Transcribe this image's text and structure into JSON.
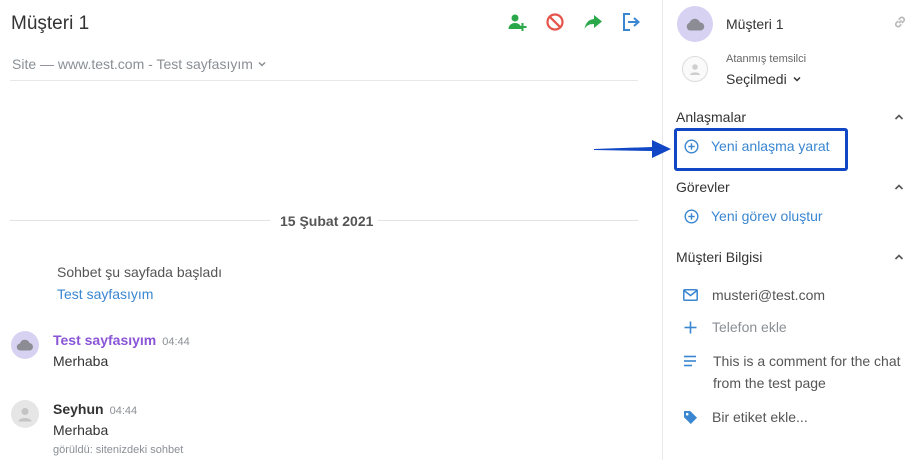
{
  "chat": {
    "title": "Müşteri 1",
    "site_line": "Site — www.test.com - Test sayfasıyım",
    "date_separator": "15 Şubat 2021",
    "system_message": "Sohbet şu sayfada başladı",
    "system_link": "Test sayfasıyım",
    "messages": [
      {
        "author": "Test sayfasıyım",
        "time": "04:44",
        "text": "Merhaba"
      },
      {
        "author": "Seyhun",
        "time": "04:44",
        "text": "Merhaba",
        "seen": "görüldü: sitenizdeki sohbet"
      }
    ]
  },
  "sidebar": {
    "customer_name": "Müşteri 1",
    "agent_label": "Atanmış temsilci",
    "agent_value": "Seçilmedi",
    "deals": {
      "title": "Anlaşmalar",
      "new_label": "Yeni anlaşma yarat"
    },
    "tasks": {
      "title": "Görevler",
      "new_label": "Yeni görev oluştur"
    },
    "info": {
      "title": "Müşteri Bilgisi",
      "email": "musteri@test.com",
      "phone_placeholder": "Telefon ekle",
      "comment": "This is a comment for the chat from the test page",
      "tag_placeholder": "Bir etiket ekle..."
    }
  },
  "colors": {
    "action_green": "#2ba84a",
    "block_red": "#e5534b",
    "link_blue": "#3a86d1",
    "highlight_blue": "#1147c4",
    "author_purple": "#8a55d6"
  }
}
